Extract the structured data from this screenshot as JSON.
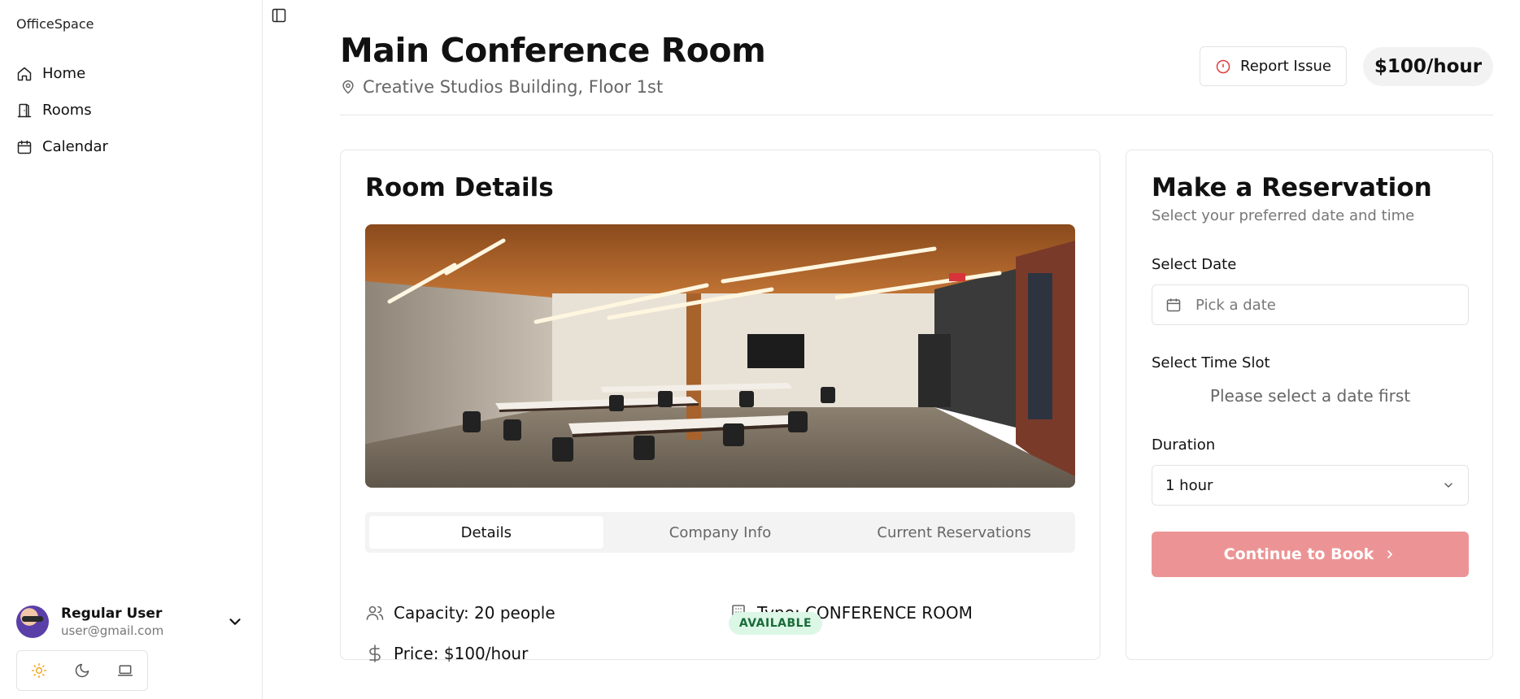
{
  "sidebar": {
    "brand": "OfficeSpace",
    "nav": [
      {
        "label": "Home",
        "icon": "home-icon"
      },
      {
        "label": "Rooms",
        "icon": "door-icon"
      },
      {
        "label": "Calendar",
        "icon": "calendar-icon"
      }
    ],
    "user": {
      "name": "Regular User",
      "email": "user@gmail.com"
    },
    "theme_options": [
      "sun-icon",
      "moon-icon",
      "laptop-icon"
    ]
  },
  "header": {
    "title": "Main Conference Room",
    "location": "Creative Studios Building, Floor 1st",
    "report_label": "Report Issue",
    "price": "$100/hour"
  },
  "room_details": {
    "title": "Room Details",
    "tabs": [
      "Details",
      "Company Info",
      "Current Reservations"
    ],
    "active_tab": "Details",
    "capacity": "Capacity: 20 people",
    "type": "Type: CONFERENCE ROOM",
    "price": "Price: $100/hour",
    "status": "AVAILABLE"
  },
  "reservation": {
    "title": "Make a Reservation",
    "subtitle": "Select your preferred date and time",
    "date_label": "Select Date",
    "date_placeholder": "Pick a date",
    "time_label": "Select Time Slot",
    "time_message": "Please select a date first",
    "duration_label": "Duration",
    "duration_value": "1 hour",
    "continue_label": "Continue to Book"
  },
  "colors": {
    "accent_disabled": "#ec9495",
    "report_icon": "#e23b3b",
    "available_bg": "#dcf7e6",
    "available_text": "#1a6b3a",
    "theme_active": "#f5a623"
  }
}
